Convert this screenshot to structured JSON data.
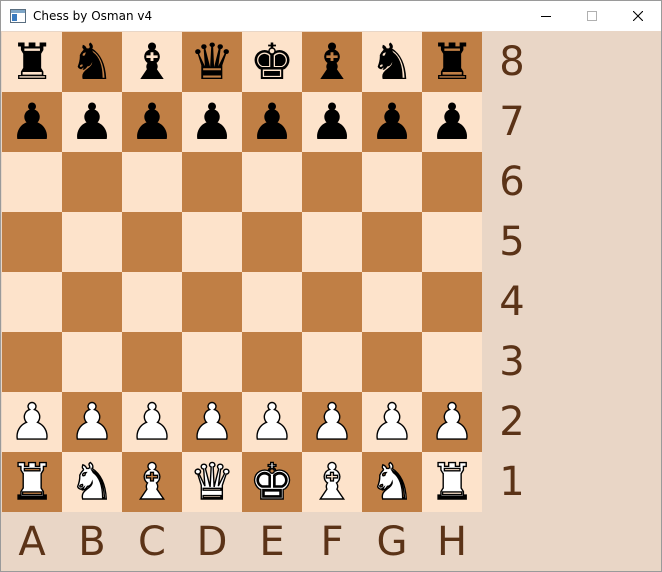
{
  "window": {
    "title": "Chess by Osman v4",
    "icon": "app-window-icon",
    "controls": {
      "minimize_icon": "minimize-icon",
      "maximize_icon": "maximize-icon",
      "close_icon": "close-icon"
    }
  },
  "colors": {
    "light_square": "#fde3cb",
    "dark_square": "#c07f45",
    "panel_background": "#e9d6c6",
    "label_color": "#5b3317"
  },
  "board": {
    "files": [
      "A",
      "B",
      "C",
      "D",
      "E",
      "F",
      "G",
      "H"
    ],
    "ranks": [
      "8",
      "7",
      "6",
      "5",
      "4",
      "3",
      "2",
      "1"
    ],
    "rows": [
      [
        "♜",
        "♞",
        "♝",
        "♛",
        "♚",
        "♝",
        "♞",
        "♜"
      ],
      [
        "♟",
        "♟",
        "♟",
        "♟",
        "♟",
        "♟",
        "♟",
        "♟"
      ],
      [
        "",
        "",
        "",
        "",
        "",
        "",
        "",
        ""
      ],
      [
        "",
        "",
        "",
        "",
        "",
        "",
        "",
        ""
      ],
      [
        "",
        "",
        "",
        "",
        "",
        "",
        "",
        ""
      ],
      [
        "",
        "",
        "",
        "",
        "",
        "",
        "",
        ""
      ],
      [
        "♟",
        "♟",
        "♟",
        "♟",
        "♟",
        "♟",
        "♟",
        "♟"
      ],
      [
        "♜",
        "♞",
        "♝",
        "♛",
        "♚",
        "♝",
        "♞",
        "♜"
      ]
    ],
    "row_colors": [
      "black",
      "black",
      "",
      "",
      "",
      "",
      "white",
      "white"
    ]
  }
}
